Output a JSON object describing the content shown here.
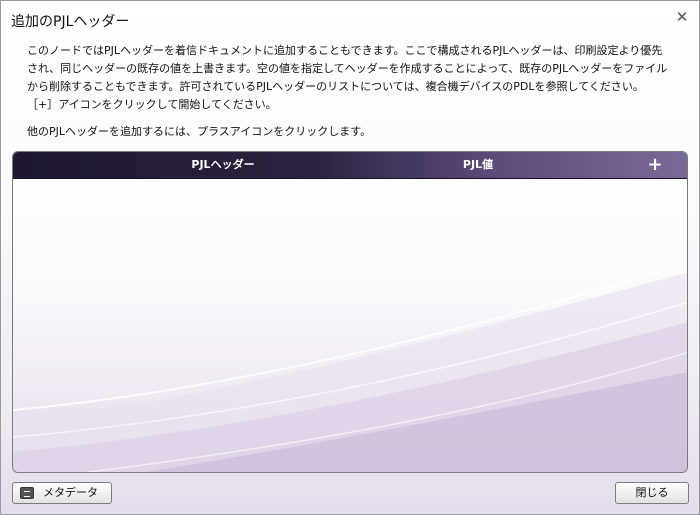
{
  "dialog": {
    "title": "追加のPJLヘッダー",
    "close_icon": "✕"
  },
  "description": {
    "line1": "このノードではPJLヘッダーを着信ドキュメントに追加することもできます。ここで構成されるPJLヘッダーは、印刷設定より優先",
    "line2": "され、同じヘッダーの既存の値を上書きます。空の値を指定してヘッダーを作成することによって、既存のPJLヘッダーをファイル",
    "line3": "から削除することもできます。許可されているPJLヘッダーのリストについては、複合機デバイスのPDLを参照してください。",
    "line4": "［+］アイコンをクリックして開始してください。"
  },
  "hint": "他のPJLヘッダーを追加するには、プラスアイコンをクリックします。",
  "table": {
    "columns": [
      "PJLヘッダー",
      "PJL値"
    ],
    "add_icon": "+",
    "rows": []
  },
  "footer": {
    "metadata_label": "メタデータ",
    "close_label": "閉じる"
  },
  "colors": {
    "header_dark": "#1f1830",
    "header_light": "#7a6a98",
    "accent_purple": "#ddd2e6"
  }
}
